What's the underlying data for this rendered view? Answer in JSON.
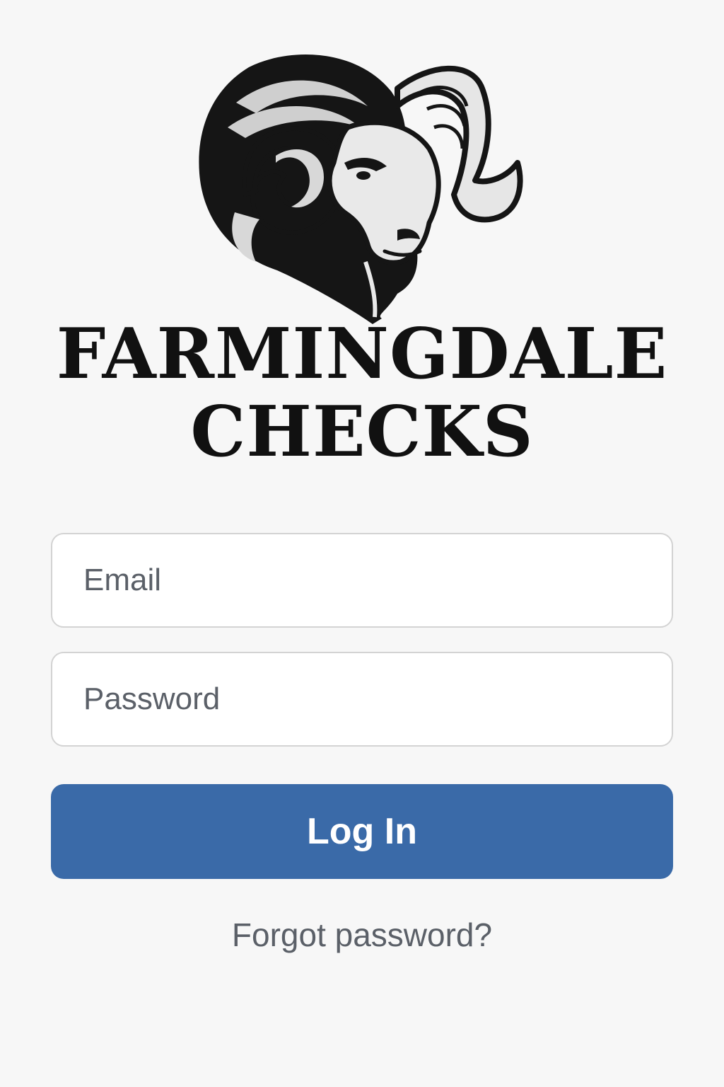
{
  "brand": {
    "line1": "FARMINGDALE",
    "line2": "CHECKS",
    "logo_icon": "ram-head-icon"
  },
  "form": {
    "email_placeholder": "Email",
    "email_value": "",
    "password_placeholder": "Password",
    "password_value": "",
    "login_label": "Log In",
    "forgot_label": "Forgot password?"
  },
  "colors": {
    "background": "#f7f7f7",
    "accent": "#3a6aa8",
    "field_border": "#d3d3d3",
    "muted_text": "#5b6068",
    "brand_text": "#111111"
  }
}
